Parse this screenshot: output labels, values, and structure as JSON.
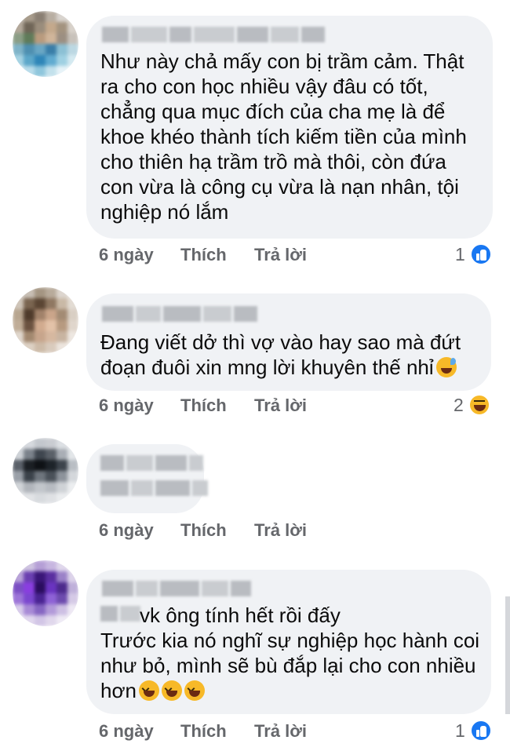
{
  "comments": [
    {
      "id": "comment-1",
      "lines": [
        "Như này chả mấy con bị trầm cảm. Thật",
        "ra cho con học nhiều vậy đâu có tốt,",
        "chẳng qua mục đích của cha mẹ là để",
        "khoe khéo thành tích kiếm tiền của mình",
        "cho thiên hạ trầm trồ mà thôi, còn đứa",
        "con vừa là công cụ vừa là nạn nhân, tội",
        "nghiệp nó lắm"
      ],
      "time": "6 ngày",
      "like_label": "Thích",
      "reply_label": "Trả lời",
      "reaction_count": "1",
      "reaction_icon": "like-reaction-icon"
    },
    {
      "id": "comment-2",
      "lines": [
        "Đang viết dở thì vợ vào hay sao mà đứt",
        "đoạn đuôi xin mng lời khuyên thế nhỉ"
      ],
      "trailing_emoji": "grinning-sweat-emoji",
      "time": "6 ngày",
      "like_label": "Thích",
      "reply_label": "Trả lời",
      "reaction_count": "2",
      "reaction_icon": "haha-reaction-icon"
    },
    {
      "id": "comment-3",
      "lines": [],
      "time": "6 ngày",
      "like_label": "Thích",
      "reply_label": "Trả lời"
    },
    {
      "id": "comment-4",
      "lines": [
        "vk ông tính hết rồi đấy",
        "Trước kia nó nghĩ sự nghiệp học hành coi",
        "như bỏ, mình sẽ bù đắp lại cho con nhiều",
        "hơn"
      ],
      "trailing_emoji": "tears-of-joy-emoji x3",
      "time": "6 ngày",
      "like_label": "Thích",
      "reply_label": "Trả lời",
      "reaction_count": "1",
      "reaction_icon": "like-reaction-icon"
    }
  ],
  "colors": {
    "bubble": "#f0f2f5",
    "text": "#050505",
    "meta": "#65676b",
    "like_blue": "#1877f2",
    "emoji_yellow": "#f7b928"
  }
}
